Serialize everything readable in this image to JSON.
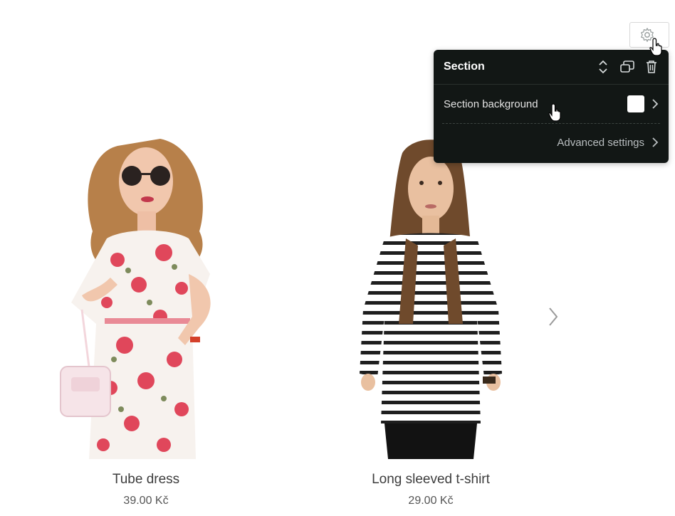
{
  "products": [
    {
      "name": "Tube dress",
      "price": "39.00 Kč",
      "image": "woman in floral dress with sunglasses and white handbag"
    },
    {
      "name": "Long sleeved t-shirt",
      "price": "29.00 Kč",
      "image": "woman in black and white striped long sleeved t-shirt"
    }
  ],
  "panel": {
    "title": "Section",
    "background_label": "Section background",
    "background_color": "#ffffff",
    "advanced_label": "Advanced settings"
  },
  "colors": {
    "panel_bg": "#121715",
    "dress_pattern": "#e0475b",
    "page_bg": "#ffffff"
  },
  "icons": [
    "gear-icon",
    "reorder-arrows-icon",
    "duplicate-icon",
    "trash-icon",
    "chevron-right-icon",
    "pointer-hand-icon"
  ]
}
